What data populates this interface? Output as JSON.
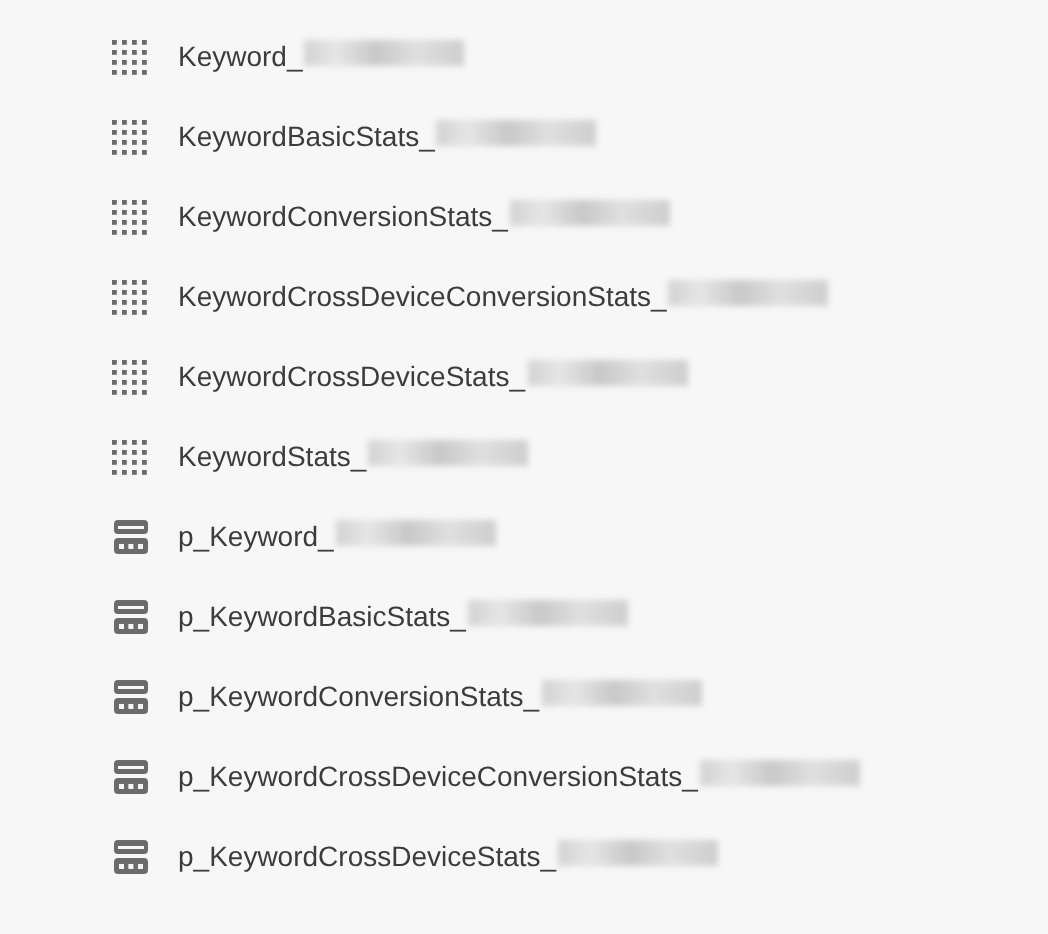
{
  "items": [
    {
      "kind": "view",
      "name": "Keyword_"
    },
    {
      "kind": "view",
      "name": "KeywordBasicStats_"
    },
    {
      "kind": "view",
      "name": "KeywordConversionStats_"
    },
    {
      "kind": "view",
      "name": "KeywordCrossDeviceConversionStats_"
    },
    {
      "kind": "view",
      "name": "KeywordCrossDeviceStats_"
    },
    {
      "kind": "view",
      "name": "KeywordStats_"
    },
    {
      "kind": "table",
      "name": "p_Keyword_"
    },
    {
      "kind": "table",
      "name": "p_KeywordBasicStats_"
    },
    {
      "kind": "table",
      "name": "p_KeywordConversionStats_"
    },
    {
      "kind": "table",
      "name": "p_KeywordCrossDeviceConversionStats_"
    },
    {
      "kind": "table",
      "name": "p_KeywordCrossDeviceStats_"
    }
  ]
}
